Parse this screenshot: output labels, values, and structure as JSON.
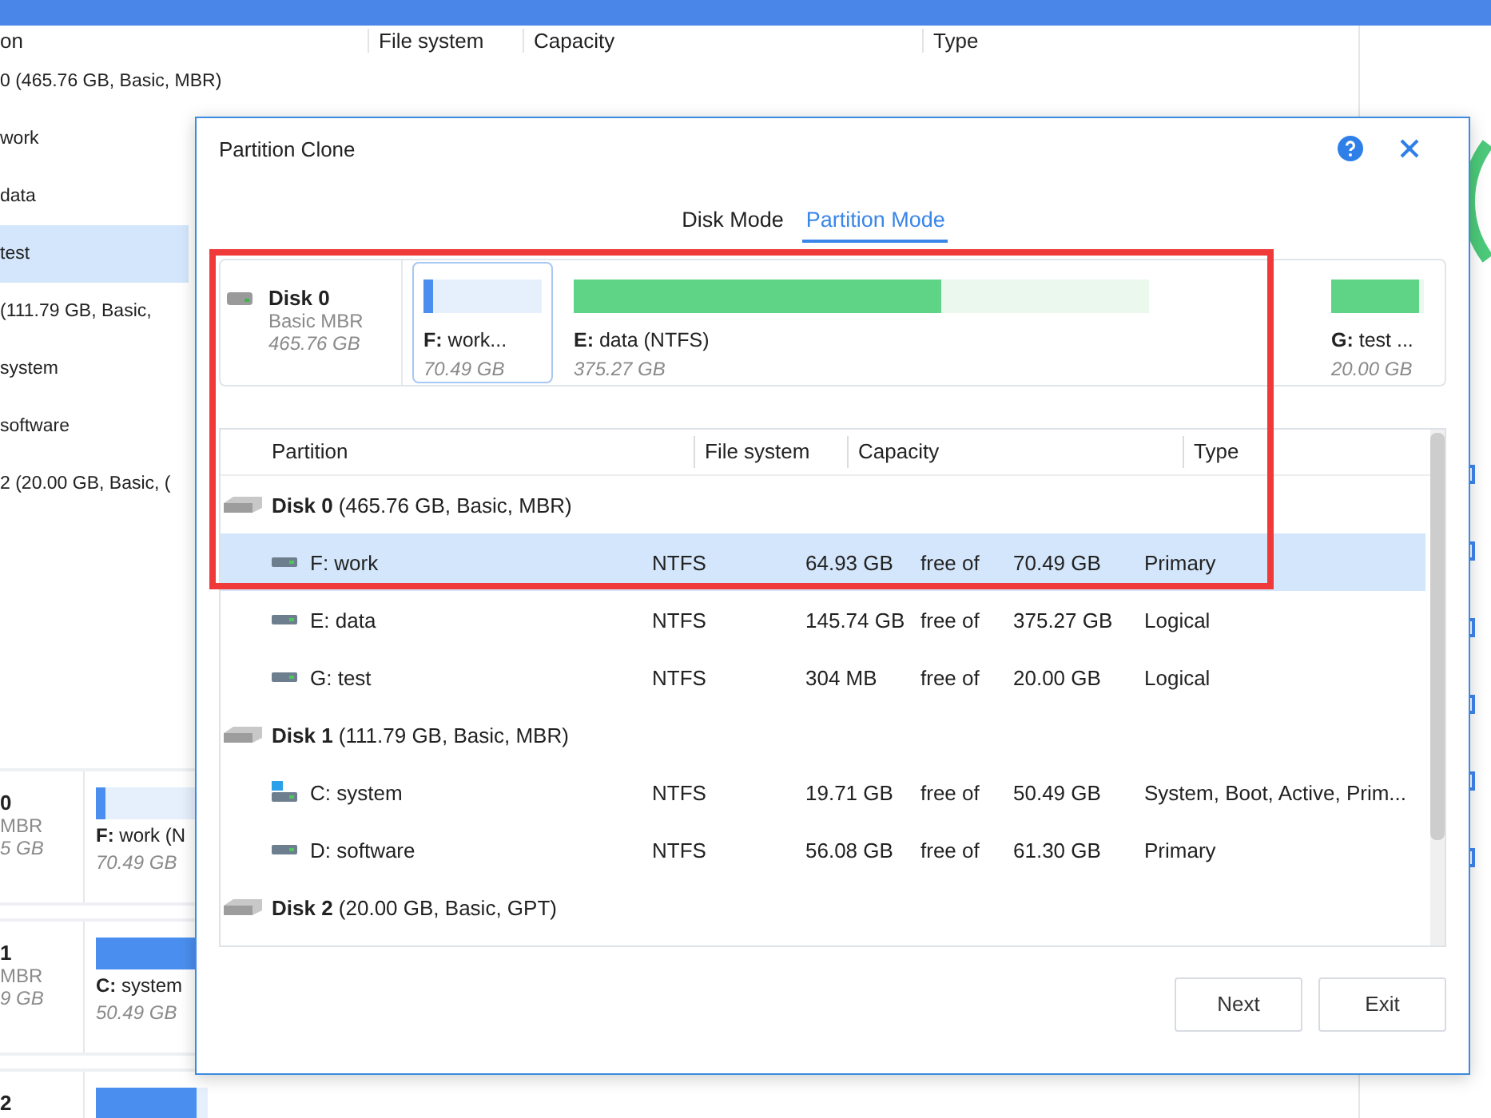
{
  "background": {
    "columns": [
      "on",
      "File system",
      "Capacity",
      "Type"
    ],
    "rows": [
      {
        "text": "0 (465.76 GB, Basic, MBR)",
        "selected": false
      },
      {
        "text": "work",
        "selected": false
      },
      {
        "text": "data",
        "selected": false
      },
      {
        "text": "test",
        "selected": true
      },
      {
        "text": "(111.79 GB, Basic,",
        "selected": false
      },
      {
        "text": "system",
        "selected": false
      },
      {
        "text": "software",
        "selected": false
      },
      {
        "text": "2 (20.00 GB, Basic, (",
        "selected": false
      }
    ],
    "disk_cards": [
      {
        "disk": "0",
        "style": "MBR",
        "size": "5 GB",
        "partition": "**F:** work (N",
        "partition_size": "70.49 GB",
        "level": 0.08
      },
      {
        "disk": "1",
        "style": "MBR",
        "size": "9 GB",
        "partition": "**C:** system",
        "partition_size": "50.49 GB",
        "level": 0.9
      },
      {
        "disk": "2",
        "level": 0.9
      }
    ]
  },
  "dialog": {
    "title": "Partition Clone",
    "tabs": [
      {
        "label": "Disk Mode",
        "selected": false
      },
      {
        "label": "Partition Mode",
        "selected": true
      }
    ],
    "disk_map": {
      "disk": "Disk 0",
      "style": "Basic MBR",
      "size": "465.76 GB",
      "partitions": [
        {
          "label": "**F:** work...",
          "size": "70.49 GB",
          "level": 0.08,
          "selected": true
        },
        {
          "label": "**E:** data (NTFS)",
          "size": "375.27 GB",
          "level": 0.64,
          "selected": false
        },
        {
          "label": "**G:** test ...",
          "size": "20.00 GB",
          "level": 0.95,
          "selected": false
        }
      ]
    },
    "table": {
      "columns": [
        "Partition",
        "File system",
        "Capacity",
        "Type"
      ],
      "rows": [
        {
          "kind": "disk",
          "label": "**Disk 0** (465.76 GB, Basic, MBR)"
        },
        {
          "kind": "partition",
          "system": false,
          "name": "F: work",
          "file_system": "NTFS",
          "free": "64.93 GB",
          "free_of": "free of",
          "total": "70.49 GB",
          "type": "Primary",
          "selected": true
        },
        {
          "kind": "partition",
          "system": false,
          "name": "E: data",
          "file_system": "NTFS",
          "free": "145.74 GB",
          "free_of": "free of",
          "total": "375.27 GB",
          "type": "Logical",
          "selected": false
        },
        {
          "kind": "partition",
          "system": false,
          "name": "G: test",
          "file_system": "NTFS",
          "free": "304 MB",
          "free_of": "free of",
          "total": "20.00 GB",
          "type": "Logical",
          "selected": false
        },
        {
          "kind": "disk",
          "label": "**Disk 1** (111.79 GB, Basic, MBR)"
        },
        {
          "kind": "partition",
          "system": true,
          "name": "C: system",
          "file_system": "NTFS",
          "free": "19.71 GB",
          "free_of": "free of",
          "total": "50.49 GB",
          "type": "System, Boot, Active, Prim...",
          "selected": false
        },
        {
          "kind": "partition",
          "system": false,
          "name": "D: software",
          "file_system": "NTFS",
          "free": "56.08 GB",
          "free_of": "free of",
          "total": "61.30 GB",
          "type": "Primary",
          "selected": false
        },
        {
          "kind": "disk",
          "label": "**Disk 2** (20.00 GB, Basic, GPT)"
        }
      ]
    },
    "buttons": [
      "Next",
      "Exit"
    ]
  }
}
